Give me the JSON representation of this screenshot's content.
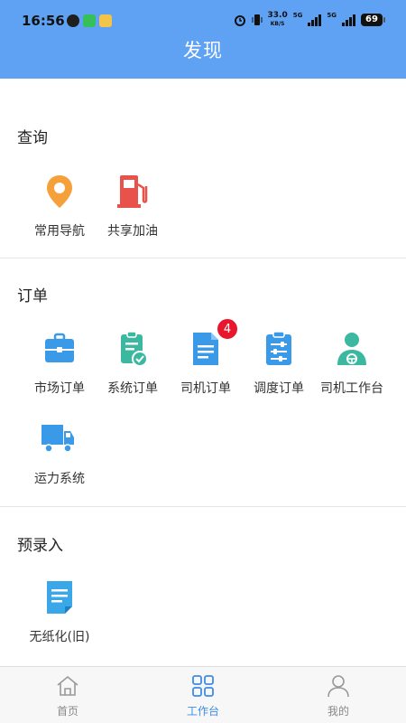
{
  "status_bar": {
    "time": "16:56",
    "speed_value": "33.0",
    "speed_unit": "KB/S",
    "network_1": "5G",
    "network_2": "5G",
    "battery": "69"
  },
  "header": {
    "title": "发现"
  },
  "sections": [
    {
      "title": "查询",
      "items": [
        {
          "label": "常用导航",
          "icon": "location-pin-icon"
        },
        {
          "label": "共享加油",
          "icon": "fuel-pump-icon"
        }
      ]
    },
    {
      "title": "订单",
      "items": [
        {
          "label": "市场订单",
          "icon": "briefcase-icon"
        },
        {
          "label": "系统订单",
          "icon": "clipboard-check-icon"
        },
        {
          "label": "司机订单",
          "icon": "document-icon",
          "badge": "4"
        },
        {
          "label": "调度订单",
          "icon": "clipboard-sliders-icon"
        },
        {
          "label": "司机工作台",
          "icon": "driver-icon"
        },
        {
          "label": "运力系统",
          "icon": "truck-icon"
        }
      ]
    },
    {
      "title": "预录入",
      "items": [
        {
          "label": "无纸化(旧)",
          "icon": "note-icon"
        }
      ]
    }
  ],
  "tabbar": {
    "tabs": [
      {
        "label": "首页",
        "icon": "home-icon",
        "active": false
      },
      {
        "label": "工作台",
        "icon": "grid-icon",
        "active": true
      },
      {
        "label": "我的",
        "icon": "user-icon",
        "active": false
      }
    ]
  },
  "colors": {
    "header_bg": "#5fa2f3",
    "accent": "#3e8ce6",
    "badge": "#e8172e",
    "nav_orange": "#f5a03a",
    "fuel_red": "#e9524a",
    "teal": "#3cb8a0",
    "blue": "#3a9ae8"
  }
}
